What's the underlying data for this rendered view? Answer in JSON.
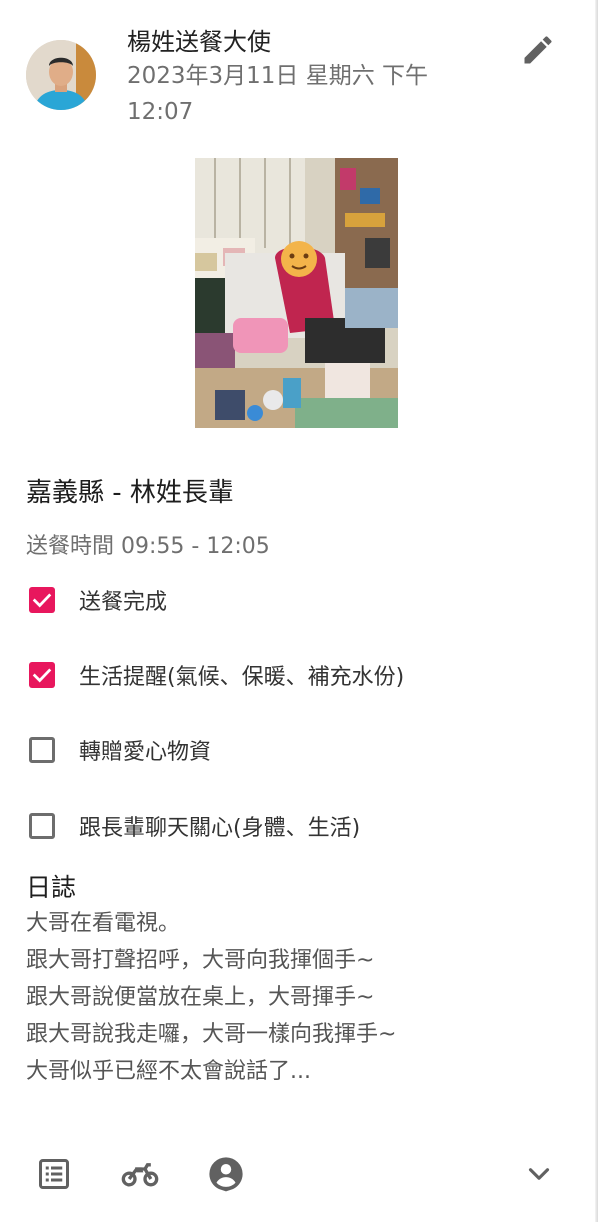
{
  "header": {
    "author_name": "楊姓送餐大使",
    "post_time": "2023年3月11日 星期六 下午 12:07",
    "edit_icon": "pencil-icon"
  },
  "elder": {
    "title": "嘉義縣 - 林姓長輩",
    "meal_time": "送餐時間 09:55 - 12:05"
  },
  "checklist": [
    {
      "label": "送餐完成",
      "checked": true
    },
    {
      "label": "生活提醒(氣候、保暖、補充水份)",
      "checked": true
    },
    {
      "label": "轉贈愛心物資",
      "checked": false
    },
    {
      "label": "跟長輩聊天關心(身體、生活)",
      "checked": false
    }
  ],
  "log": {
    "heading": "日誌",
    "lines": [
      "大哥在看電視。",
      "跟大哥打聲招呼，大哥向我揮個手~",
      "跟大哥說便當放在桌上，大哥揮手~",
      "跟大哥說我走囉，大哥一樣向我揮手~",
      "大哥似乎已經不太會說話了..."
    ]
  },
  "footer": {
    "icons": [
      "list-icon",
      "motorcycle-icon",
      "person-pin-icon",
      "chevron-down-icon"
    ]
  },
  "colors": {
    "accent": "#e8175d",
    "text_secondary": "#6f6f6f",
    "icon_grey": "#616161"
  }
}
